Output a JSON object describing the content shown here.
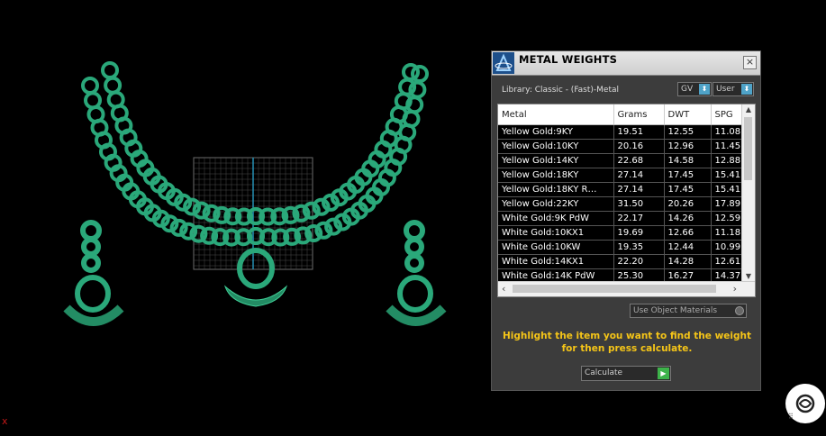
{
  "dialog": {
    "title": "METAL WEIGHTS",
    "close_label": "×",
    "library_label": "Library: Classic - (Fast)-Metal",
    "gv_combo": "GV",
    "user_combo": "User",
    "use_object_materials": "Use Object Materials",
    "hint": "Highlight the item you want to find the weight for then press calculate.",
    "calculate_label": "Calculate"
  },
  "table": {
    "headers": [
      "Metal",
      "Grams",
      "DWT",
      "SPG"
    ],
    "rows": [
      [
        "Yellow Gold:9KY",
        "19.51",
        "12.55",
        "11.08"
      ],
      [
        "Yellow Gold:10KY",
        "20.16",
        "12.96",
        "11.45"
      ],
      [
        "Yellow Gold:14KY",
        "22.68",
        "14.58",
        "12.88"
      ],
      [
        "Yellow Gold:18KY",
        "27.14",
        "17.45",
        "15.41"
      ],
      [
        "Yellow Gold:18KY R…",
        "27.14",
        "17.45",
        "15.41"
      ],
      [
        "Yellow Gold:22KY",
        "31.50",
        "20.26",
        "17.89"
      ],
      [
        "White Gold:9K PdW",
        "22.17",
        "14.26",
        "12.59"
      ],
      [
        "White Gold:10KX1",
        "19.69",
        "12.66",
        "11.18"
      ],
      [
        "White Gold:10KW",
        "19.35",
        "12.44",
        "10.99"
      ],
      [
        "White Gold:14KX1",
        "22.20",
        "14.28",
        "12.61"
      ],
      [
        "White Gold:14K PdW",
        "25.30",
        "16.27",
        "14.37"
      ]
    ]
  },
  "colors": {
    "jewel_green": "#2aa87a",
    "hint_yellow": "#f5c518",
    "combo_arrow_blue": "#4fa3c8",
    "calc_green": "#3db34a"
  },
  "icons": {
    "app": "cad-logo-icon",
    "close": "close-icon",
    "badge": "chat-assistant-icon"
  },
  "viewport": {
    "corner_mark": "x"
  }
}
